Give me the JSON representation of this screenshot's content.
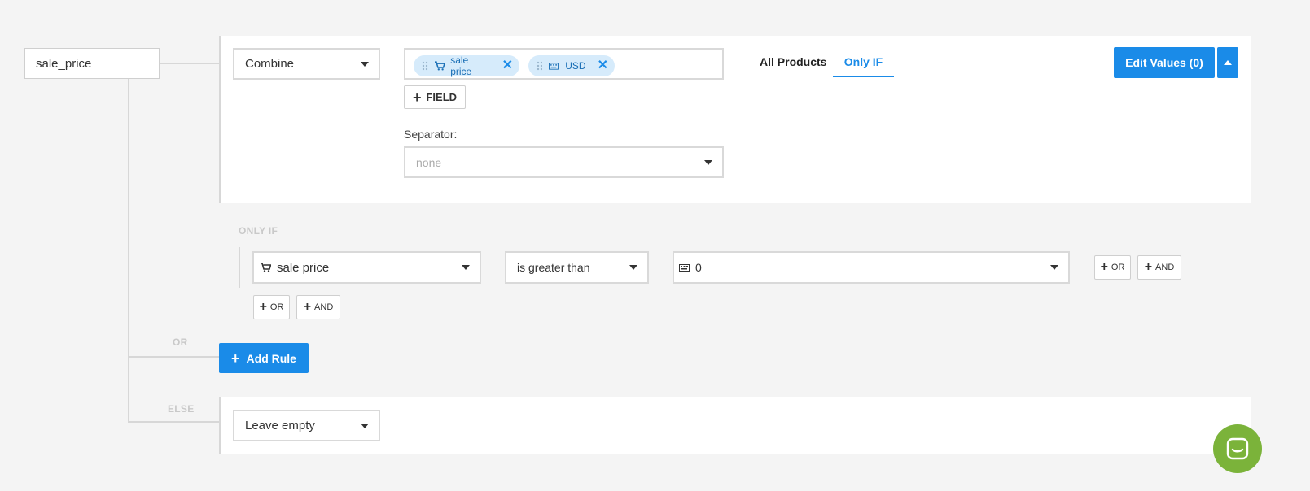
{
  "field_name": "sale_price",
  "combine": {
    "operation": "Combine",
    "chips": [
      {
        "icon": "cart-icon",
        "label": "sale price"
      },
      {
        "icon": "keyboard-icon",
        "label": "USD"
      }
    ],
    "add_field_label": "FIELD",
    "separator_label": "Separator:",
    "separator_placeholder": "none"
  },
  "tabs": {
    "all_products": "All Products",
    "only_if": "Only IF",
    "active": "only_if"
  },
  "edit_values_label": "Edit Values (0)",
  "condition": {
    "section_label": "ONLY IF",
    "field": "sale price",
    "operator": "is greater than",
    "value": "0",
    "or_label": "OR",
    "and_label": "AND"
  },
  "or_label": "OR",
  "add_rule_label": "Add Rule",
  "else": {
    "label": "ELSE",
    "value": "Leave empty"
  },
  "colors": {
    "accent": "#1a8be8",
    "chip_bg": "#d6ebfb",
    "chat_green": "#7bb33a"
  }
}
